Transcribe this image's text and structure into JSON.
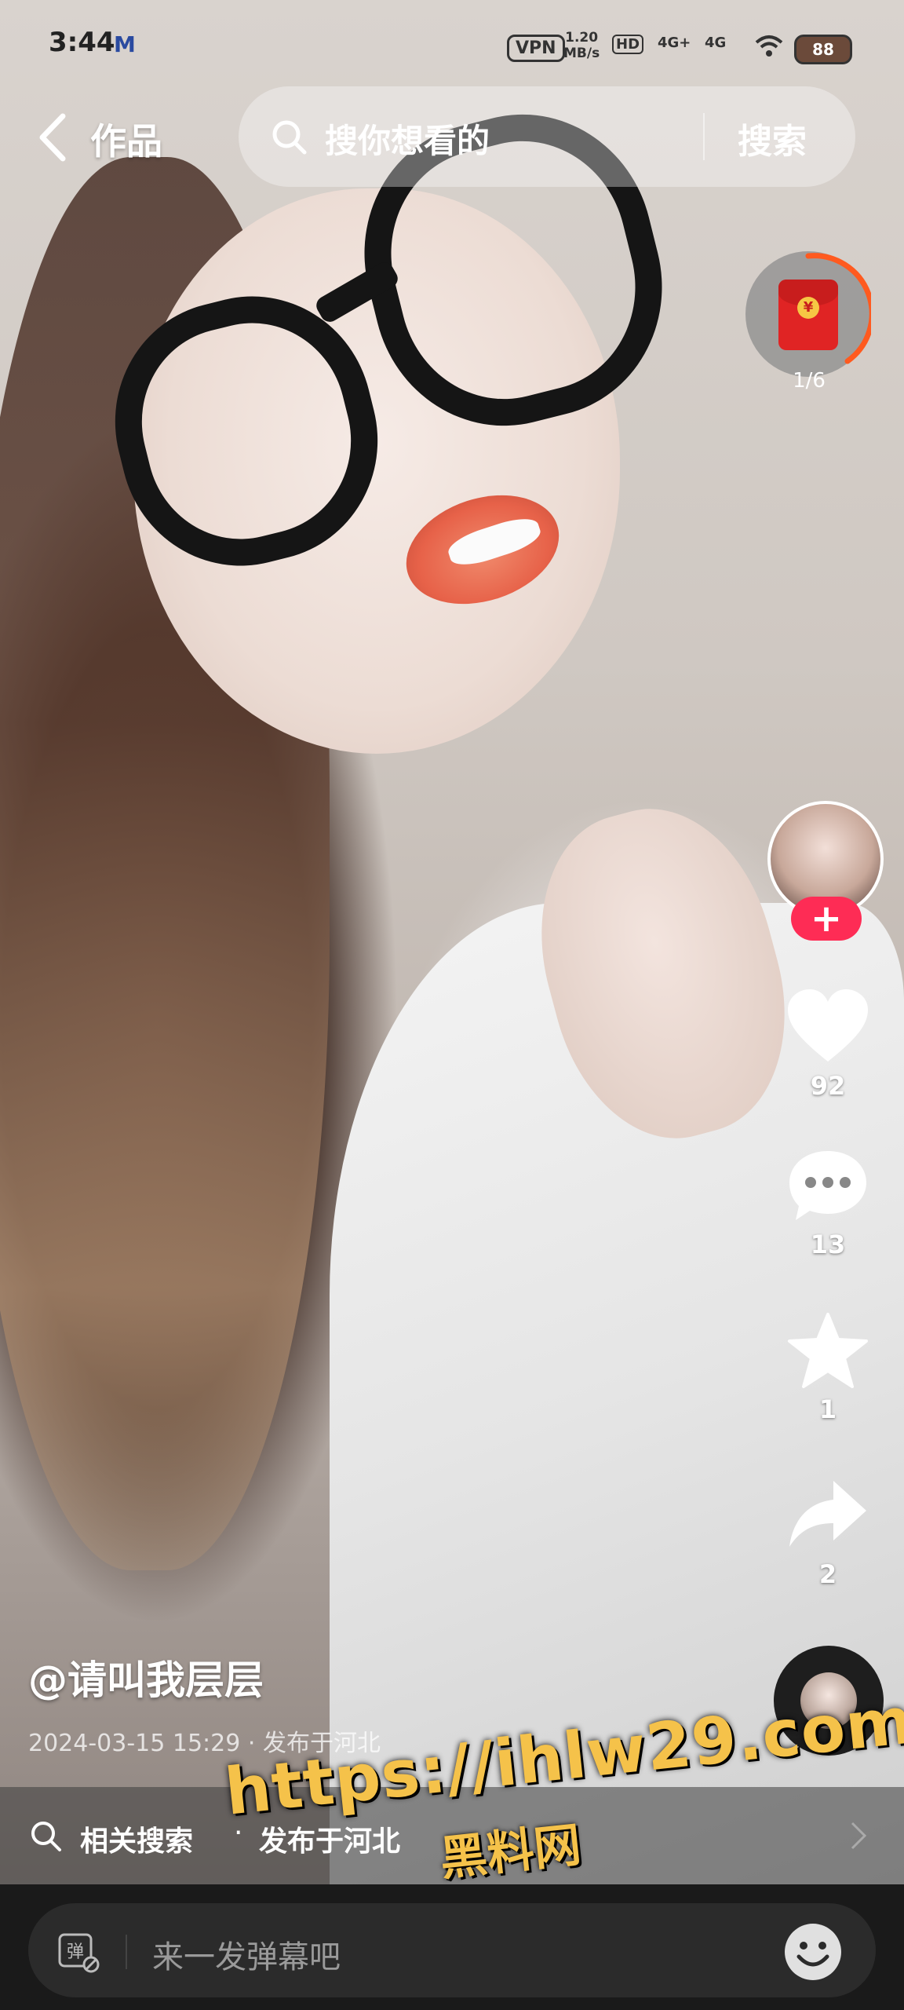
{
  "status_bar": {
    "time": "3:44",
    "app_icon": "M",
    "vpn": "VPN",
    "speed_value": "1.20",
    "speed_unit": "MB/s",
    "hd": "HD",
    "signal1": "4G+",
    "signal2": "4G",
    "battery": "88"
  },
  "top_nav": {
    "title": "作品",
    "search_placeholder": "搜你想看的",
    "search_button": "搜索"
  },
  "red_packet": {
    "count": "1/6"
  },
  "side_rail": {
    "follow": "+",
    "likes": "92",
    "comments": "13",
    "favorites": "1",
    "shares": "2"
  },
  "post": {
    "author": "@请叫我层层",
    "meta": "2024-03-15 15:29 · 发布于河北"
  },
  "related": {
    "label": "相关搜索",
    "separator": "·",
    "query": "发布于河北"
  },
  "watermark": {
    "url": "https://ihlw29.com",
    "site_name": "黑料网"
  },
  "comment_bar": {
    "danmu_icon": "弹",
    "placeholder": "来一发弹幕吧"
  },
  "colors": {
    "follow_button": "#fe2c55",
    "watermark": "#f5c24a",
    "red_packet": "#e02424"
  }
}
